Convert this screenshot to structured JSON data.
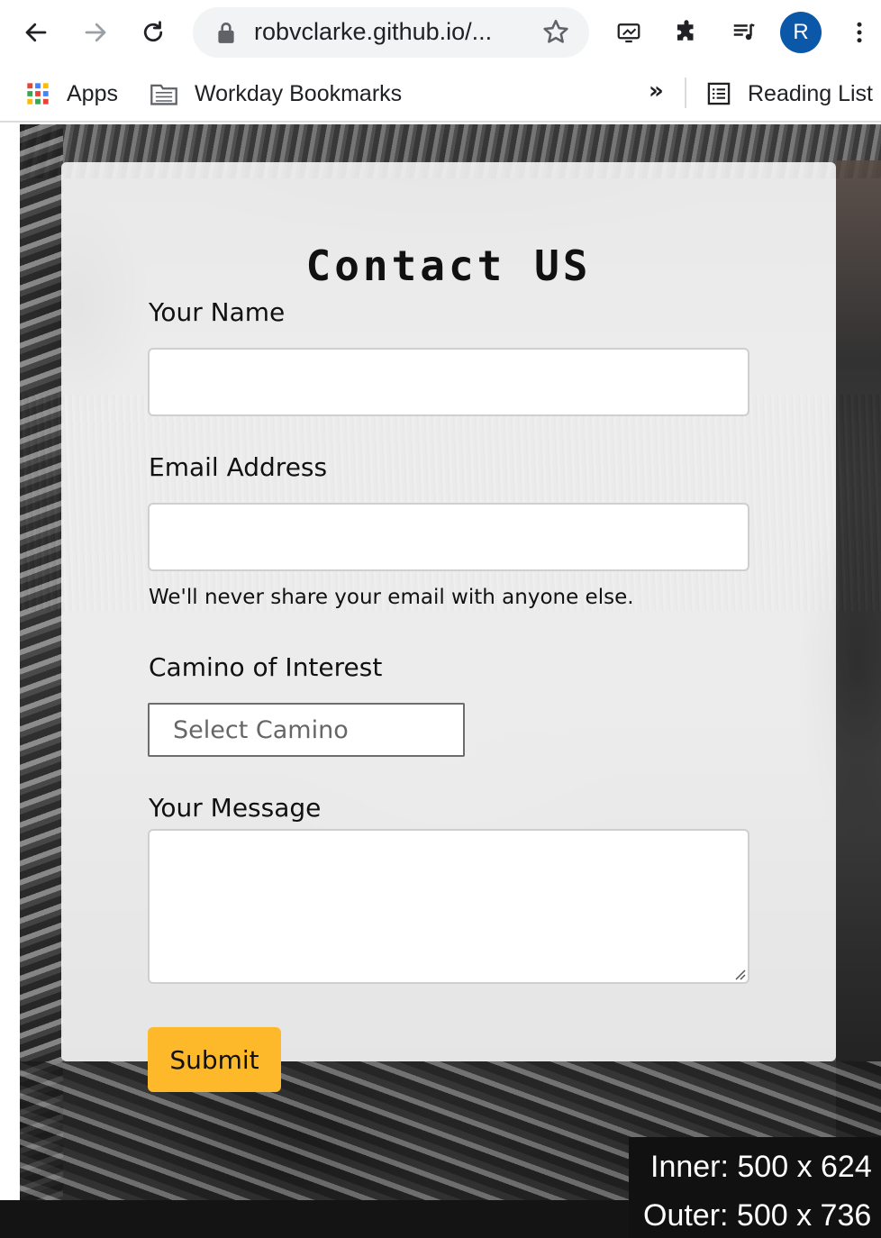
{
  "browser": {
    "url": "robvclarke.github.io/...",
    "profile_initial": "R",
    "bookmarks": [
      {
        "label": "Apps",
        "icon": "apps-grid-icon"
      },
      {
        "label": "Workday Bookmarks",
        "icon": "folder-icon"
      }
    ],
    "overflow_label": "»",
    "reading_list_label": "Reading List"
  },
  "contact_form": {
    "title": "Contact US",
    "name_label": "Your Name",
    "name_value": "",
    "email_label": "Email Address",
    "email_value": "",
    "email_help": "We'll never share your email with anyone else.",
    "camino_label": "Camino of Interest",
    "camino_selected": "Select Camino",
    "message_label": "Your Message",
    "message_value": "",
    "submit_label": "Submit"
  },
  "size_overlay": {
    "inner": "Inner: 500 x 624",
    "outer": "Outer: 500 x 736"
  },
  "colors": {
    "submit_button": "#fdb92a",
    "avatar": "#0b57a8",
    "card_background": "#f6f6f6"
  }
}
